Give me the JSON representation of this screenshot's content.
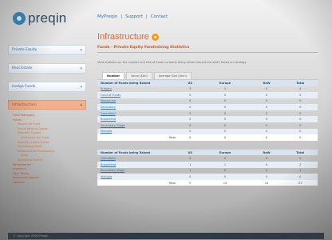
{
  "header": {
    "logo_text": "preqin",
    "links": [
      "MyPreqin",
      "Support",
      "Contact"
    ],
    "link_sep": "|"
  },
  "sidebar": {
    "boxes": [
      {
        "label": "Private Equity"
      },
      {
        "label": "Real Estate"
      },
      {
        "label": "Hedge Funds"
      }
    ],
    "active": {
      "label": "Infrastructure"
    },
    "items": [
      {
        "label": "Fund Managers",
        "level": 0
      },
      {
        "label": "Funds",
        "level": 0
      },
      {
        "label": "Search for Fund",
        "level": 1
      },
      {
        "label": "Funds Raising Capital",
        "level": 1
      },
      {
        "label": "Recently Closed",
        "level": 1
      },
      {
        "label": "Infrastructure Funds",
        "level": 2
      },
      {
        "label": "Recently Listed Funds",
        "level": 1
      },
      {
        "label": "Fundraising Stats",
        "level": 1
      },
      {
        "label": "Infrastructure Fundraising",
        "level": 1
      },
      {
        "label": "Stats",
        "level": 2
      },
      {
        "label": "Advanced Search",
        "level": 1
      },
      {
        "label": "Performance",
        "level": 0
      },
      {
        "label": "Investors",
        "level": 0
      },
      {
        "label": "Deal Terms",
        "level": 0
      },
      {
        "label": "Placement Agents",
        "level": 0
      },
      {
        "label": "Lawyers",
        "level": 0
      }
    ]
  },
  "main": {
    "title": "Infrastructure",
    "subtitle": "Funds - Private Equity Fundraising Statistics",
    "description": "View statistics on the number and size of funds currently being raised around the world based on strategy.",
    "tabs": [
      "Number",
      "Value ($bn)",
      "Average Size ($mn)"
    ],
    "table1": {
      "headers": [
        "Number of Funds being Raised",
        "US",
        "Europe",
        "RoW",
        "Total"
      ],
      "rows": [
        [
          "Primary",
          "3",
          "1",
          "0",
          "4"
        ],
        [
          "Fund of Funds",
          "0",
          "0",
          "0",
          "0"
        ],
        [
          "Mezzanine",
          "0",
          "0",
          "0",
          "0"
        ],
        [
          "Secondary",
          "0",
          "0",
          "0",
          "0"
        ],
        [
          "Greenfield",
          "0",
          "0",
          "0",
          "0"
        ],
        [
          "Brownfield",
          "0",
          "0",
          "0",
          "0"
        ],
        [
          "Secondary Stage",
          "0",
          "0",
          "0",
          "0"
        ],
        [
          "Multiple",
          "0",
          "0",
          "0",
          "0"
        ]
      ],
      "total": [
        "Total",
        "0",
        "0",
        "0",
        "0"
      ]
    },
    "table2": {
      "headers": [
        "Number of Funds being Raised",
        "US",
        "Europe",
        "RoW",
        "Total"
      ],
      "rows": [
        [
          "Greenfield",
          "0",
          "0",
          "0",
          "0"
        ],
        [
          "Brownfield",
          "1",
          "1",
          "0",
          "2"
        ],
        [
          "Secondary stage",
          "1",
          "0",
          "0",
          "1"
        ],
        [
          "Multiple",
          "0",
          "0",
          "0",
          "0"
        ]
      ],
      "total": [
        "Total",
        "0",
        "13",
        "14",
        "27"
      ]
    }
  },
  "footer": {
    "text": "© copyright 2009 Preqin"
  }
}
